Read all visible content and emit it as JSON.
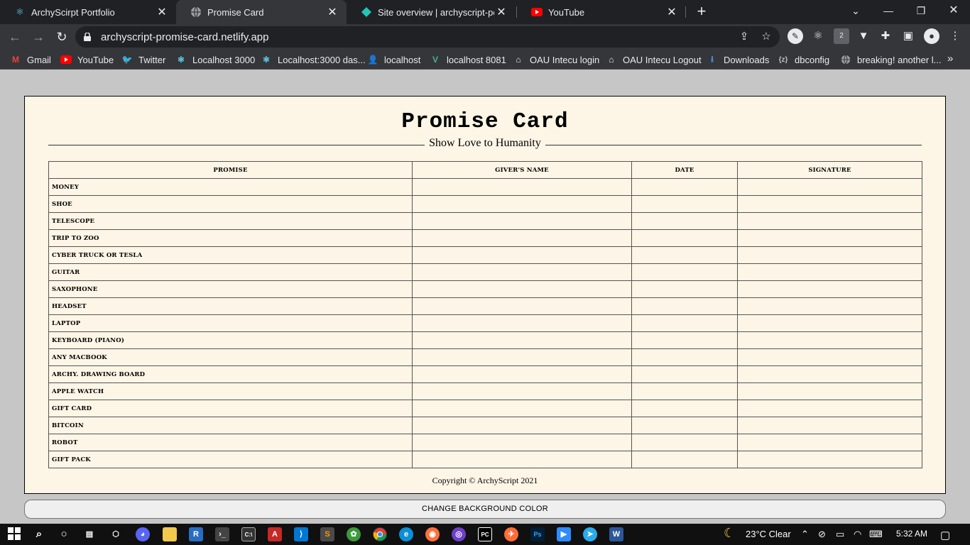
{
  "browser": {
    "tabs": [
      {
        "title": "ArchyScirpt Portfolio",
        "icon": "react-icon",
        "active": false
      },
      {
        "title": "Promise Card",
        "icon": "globe-icon",
        "active": true
      },
      {
        "title": "Site overview | archyscript-portfo",
        "icon": "netlify-icon",
        "active": false
      },
      {
        "title": "YouTube",
        "icon": "youtube-icon",
        "active": false
      }
    ],
    "url": "archyscript-promise-card.netlify.app",
    "bookmarks": [
      {
        "label": "Gmail",
        "icon": "gmail-icon",
        "color": "#ea4335"
      },
      {
        "label": "YouTube",
        "icon": "youtube-icon",
        "color": "#ff0000"
      },
      {
        "label": "Twitter",
        "icon": "twitter-icon",
        "color": "#1da1f2"
      },
      {
        "label": "Localhost 3000",
        "icon": "react-icon",
        "color": "#61dafb"
      },
      {
        "label": "Localhost:3000 das...",
        "icon": "react-icon",
        "color": "#61dafb"
      },
      {
        "label": "localhost",
        "icon": "avatar-icon",
        "color": "#d08a5a"
      },
      {
        "label": "localhost 8081",
        "icon": "vue-icon",
        "color": "#41b883"
      },
      {
        "label": "OAU Intecu login",
        "icon": "home-icon",
        "color": "#e8eaed"
      },
      {
        "label": "OAU Intecu Logout",
        "icon": "home-icon",
        "color": "#e8eaed"
      },
      {
        "label": "Downloads",
        "icon": "download-icon",
        "color": "#4a90e2"
      },
      {
        "label": "dbconfig",
        "icon": "braces-icon",
        "color": "#bdc1c6"
      },
      {
        "label": "breaking! another l...",
        "icon": "globe-icon",
        "color": "#bdc1c6"
      }
    ]
  },
  "page": {
    "title": "Promise Card",
    "subtitle": "Show Love to Humanity",
    "columns": [
      "Promise",
      "Giver's Name",
      "Date",
      "Signature"
    ],
    "items": [
      "Money",
      "Shoe",
      "Telescope",
      "Trip to Zoo",
      "Cyber Truck or Tesla",
      "Guitar",
      "Saxophone",
      "Headset",
      "Laptop",
      "Keyboard (Piano)",
      "Any Macbook",
      "Archy. Drawing Board",
      "Apple Watch",
      "Gift Card",
      "Bitcoin",
      "Robot",
      "Gift Pack"
    ],
    "copyright": "Copyright © ArchyScript 2021",
    "change_bg_label": "CHANGE BACKGROUND COLOR",
    "background_color": "#fdf5e6"
  },
  "taskbar": {
    "weather": "23°C  Clear",
    "time": "5:32 AM"
  }
}
